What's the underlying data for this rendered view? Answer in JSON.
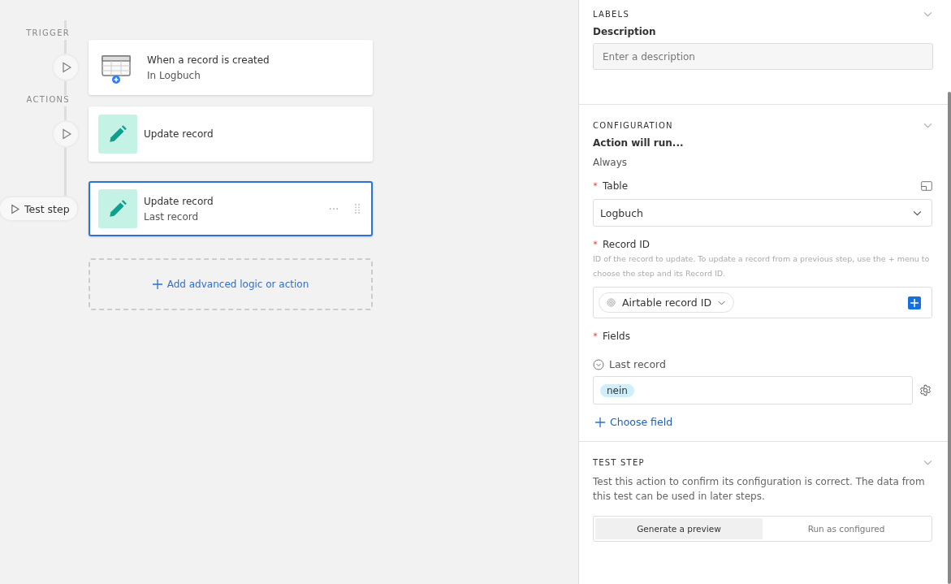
{
  "flow": {
    "trigger_heading": "TRIGGER",
    "actions_heading": "ACTIONS",
    "steps": [
      {
        "kind": "trigger",
        "title": "When a record is created",
        "subtitle": "In Logbuch",
        "selected": false
      },
      {
        "kind": "action",
        "title": "Update record",
        "selected": false
      },
      {
        "kind": "action",
        "title": "Update record",
        "subtitle": "Last record",
        "selected": true,
        "side_button": "Test step"
      }
    ],
    "add_button": "Add advanced logic or action"
  },
  "panel": {
    "labels": {
      "heading": "LABELS",
      "description_label": "Description",
      "description_placeholder": "Enter a description"
    },
    "configuration": {
      "heading": "CONFIGURATION",
      "run_label": "Action will run...",
      "run_value": "Always",
      "table_required": true,
      "record_id_required": true,
      "fields_required": true,
      "table_label": "Table",
      "table_value": "Logbuch",
      "record_id_label": "Record ID",
      "record_id_help": "ID of the record to update. To update a record from a previous step, use the + menu to choose the step and its Record ID.",
      "record_id_token": "Airtable record ID",
      "fields_label": "Fields",
      "field_name": "Last record",
      "field_value": "nein",
      "choose_field": "Choose field"
    },
    "test_step": {
      "heading": "TEST STEP",
      "text": "Test this action to confirm its configuration is correct. The data from this test can be used in later steps.",
      "modes": [
        {
          "label": "Generate a preview",
          "selected": true
        },
        {
          "label": "Run as configured",
          "selected": false
        }
      ]
    }
  }
}
